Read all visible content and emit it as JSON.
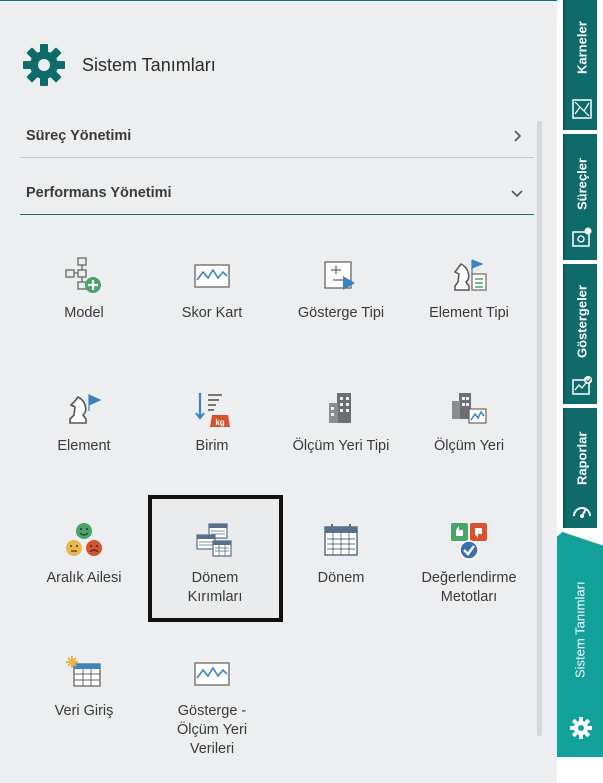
{
  "header": {
    "title": "Sistem Tanımları",
    "icon": "gear-icon"
  },
  "sections": [
    {
      "label": "Süreç Yönetimi",
      "state": "collapsed",
      "icon": "chevron-right-icon"
    },
    {
      "label": "Performans Yönetimi",
      "state": "expanded",
      "icon": "chevron-down-icon"
    }
  ],
  "items": [
    {
      "label": "Model",
      "icon": "model-tree-add-icon"
    },
    {
      "label": "Skor Kart",
      "icon": "scorecard-chart-icon"
    },
    {
      "label": "Gösterge Tipi",
      "icon": "indicator-type-icon"
    },
    {
      "label": "Element Tipi",
      "icon": "element-type-icon"
    },
    {
      "label": "Element",
      "icon": "chess-flag-icon"
    },
    {
      "label": "Birim",
      "icon": "unit-weight-icon"
    },
    {
      "label": "Ölçüm Yeri Tipi",
      "icon": "building-icon"
    },
    {
      "label": "Ölçüm Yeri",
      "icon": "building-chart-icon"
    },
    {
      "label": "Aralık Ailesi",
      "icon": "smiley-faces-icon"
    },
    {
      "label": "Dönem\nKırımları",
      "icon": "calendar-stack-icon",
      "selected": true
    },
    {
      "label": "Dönem",
      "icon": "calendar-icon"
    },
    {
      "label": "Değerlendirme\nMetotları",
      "icon": "thumbs-check-icon"
    },
    {
      "label": "Veri Giriş",
      "icon": "data-entry-table-icon"
    },
    {
      "label": "Gösterge -\nÖlçüm Yeri\nVerileri",
      "icon": "chart-line-icon"
    }
  ],
  "tabs": [
    {
      "label": "Karneler",
      "icon": "scorecard-icon"
    },
    {
      "label": "Süreçler",
      "icon": "process-icon"
    },
    {
      "label": "Göstergeler",
      "icon": "indicators-icon"
    },
    {
      "label": "Raporlar",
      "icon": "reports-icon"
    },
    {
      "label": "Sistem Tanımları",
      "icon": "gear-icon",
      "active": true
    }
  ],
  "colors": {
    "accent": "#0e6b6a",
    "active_tab": "#13a19c",
    "panel_bg": "#eceef0"
  }
}
